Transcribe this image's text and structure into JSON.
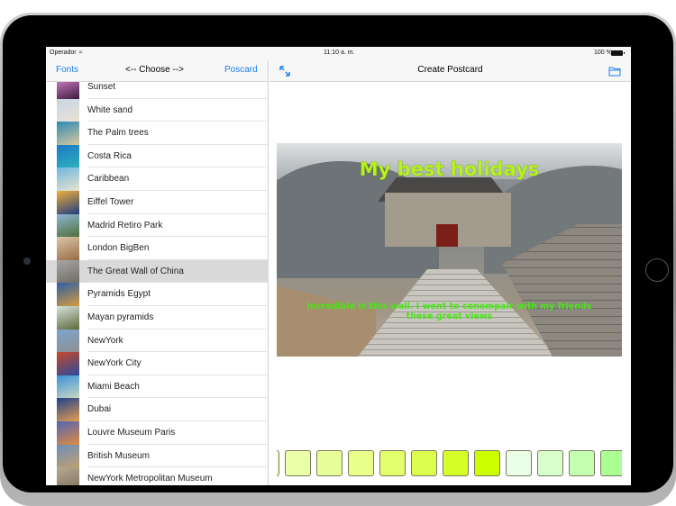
{
  "status_bar": {
    "carrier": "Operador",
    "time": "11:10 a. m.",
    "battery": "100 %"
  },
  "master": {
    "nav": {
      "left_button": "Fonts",
      "title": "<-- Choose -->",
      "right_button": "Poscard"
    },
    "items": [
      {
        "label": "Sunset",
        "thumb": [
          "#e48ad8",
          "#3a1b3c"
        ]
      },
      {
        "label": "White sand",
        "thumb": [
          "#c7d6e4",
          "#e9e2d6"
        ]
      },
      {
        "label": "The Palm trees",
        "thumb": [
          "#2f8ab5",
          "#d8c89c"
        ]
      },
      {
        "label": "Costa Rica",
        "thumb": [
          "#1c79c3",
          "#2fb0c0"
        ]
      },
      {
        "label": "Caribbean",
        "thumb": [
          "#6fb6df",
          "#e9e4d0"
        ]
      },
      {
        "label": "Eiffel Tower",
        "thumb": [
          "#f0b03a",
          "#1c3d80"
        ]
      },
      {
        "label": "Madrid Retiro Park",
        "thumb": [
          "#8fb7d4",
          "#4f6e3a"
        ]
      },
      {
        "label": "London BigBen",
        "thumb": [
          "#d9c7a8",
          "#9a6b46"
        ]
      },
      {
        "label": "The Great Wall of China",
        "thumb": [
          "#a7a7a7",
          "#6f6a63"
        ],
        "selected": true
      },
      {
        "label": "Pyramids Egypt",
        "thumb": [
          "#2d5fa8",
          "#d49a3a"
        ]
      },
      {
        "label": "Mayan pyramids",
        "thumb": [
          "#d8e2dc",
          "#5b6b3b"
        ]
      },
      {
        "label": "NewYork",
        "thumb": [
          "#7da6cf",
          "#8f8f8f"
        ]
      },
      {
        "label": "NewYork City",
        "thumb": [
          "#c34a2a",
          "#2a4a9a"
        ]
      },
      {
        "label": "Miami Beach",
        "thumb": [
          "#3a93d8",
          "#c9d6c0"
        ]
      },
      {
        "label": "Dubai",
        "thumb": [
          "#1f3f8a",
          "#e5a050"
        ]
      },
      {
        "label": "Louvre Museum Paris",
        "thumb": [
          "#5166b5",
          "#e08a40"
        ]
      },
      {
        "label": "British Museum",
        "thumb": [
          "#6c8fb8",
          "#c0a070"
        ]
      },
      {
        "label": "NewYork Metropolitan Museum",
        "thumb": [
          "#b8aa90",
          "#7d7060"
        ]
      }
    ]
  },
  "detail": {
    "nav": {
      "title": "Create Postcard",
      "left_icon": "expand-arrows-icon",
      "right_icon": "folder-icon"
    },
    "postcard": {
      "image": "The Great Wall of China",
      "title": "My best holidays",
      "message": "Incredible is this wall. I went to conompair with my friends these great views"
    },
    "swatches": [
      "#e9ffa8",
      "#e8ff99",
      "#eaff8a",
      "#e3ff6b",
      "#dcff4d",
      "#d4ff2a",
      "#ccff00",
      "#eaffe6",
      "#d8ffcc",
      "#c4ffb0",
      "#acff94"
    ],
    "partial_swatch_left": "#f0ffb8"
  }
}
